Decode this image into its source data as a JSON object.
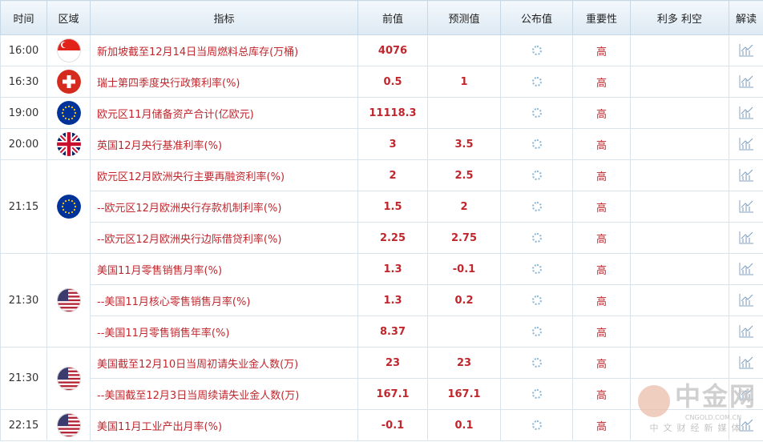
{
  "headers": {
    "time": "时间",
    "region": "区域",
    "indicator": "指标",
    "previous": "前值",
    "forecast": "预测值",
    "published": "公布值",
    "importance": "重要性",
    "bull_bear": "利多 利空",
    "analysis": "解读"
  },
  "groups": [
    {
      "time": "16:00",
      "flag": "singapore-flag-icon",
      "rows": [
        {
          "indicator": "新加坡截至12月14日当周燃料总库存(万桶)",
          "previous": "4076",
          "forecast": "",
          "importance": "高"
        }
      ]
    },
    {
      "time": "16:30",
      "flag": "switzerland-flag-icon",
      "rows": [
        {
          "indicator": "瑞士第四季度央行政策利率(%)",
          "previous": "0.5",
          "forecast": "1",
          "importance": "高"
        }
      ]
    },
    {
      "time": "19:00",
      "flag": "eu-flag-icon",
      "rows": [
        {
          "indicator": "欧元区11月储备资产合计(亿欧元)",
          "previous": "11118.3",
          "forecast": "",
          "importance": "高"
        }
      ]
    },
    {
      "time": "20:00",
      "flag": "uk-flag-icon",
      "rows": [
        {
          "indicator": "英国12月央行基准利率(%)",
          "previous": "3",
          "forecast": "3.5",
          "importance": "高"
        }
      ]
    },
    {
      "time": "21:15",
      "flag": "eu-flag-icon",
      "rows": [
        {
          "indicator": "欧元区12月欧洲央行主要再融资利率(%)",
          "previous": "2",
          "forecast": "2.5",
          "importance": "高"
        },
        {
          "indicator": "--欧元区12月欧洲央行存款机制利率(%)",
          "previous": "1.5",
          "forecast": "2",
          "importance": "高"
        },
        {
          "indicator": "--欧元区12月欧洲央行边际借贷利率(%)",
          "previous": "2.25",
          "forecast": "2.75",
          "importance": "高"
        }
      ]
    },
    {
      "time": "21:30",
      "flag": "us-flag-icon",
      "rows": [
        {
          "indicator": "美国11月零售销售月率(%)",
          "previous": "1.3",
          "forecast": "-0.1",
          "importance": "高"
        },
        {
          "indicator": "--美国11月核心零售销售月率(%)",
          "previous": "1.3",
          "forecast": "0.2",
          "importance": "高"
        },
        {
          "indicator": "--美国11月零售销售年率(%)",
          "previous": "8.37",
          "forecast": "",
          "importance": "高"
        }
      ]
    },
    {
      "time": "21:30",
      "flag": "us-flag-icon",
      "rows": [
        {
          "indicator": "美国截至12月10日当周初请失业金人数(万)",
          "previous": "23",
          "forecast": "23",
          "importance": "高"
        },
        {
          "indicator": "--美国截至12月3日当周续请失业金人数(万)",
          "previous": "167.1",
          "forecast": "167.1",
          "importance": "高"
        }
      ]
    },
    {
      "time": "22:15",
      "flag": "us-flag-icon",
      "rows": [
        {
          "indicator": "美国11月工业产出月率(%)",
          "previous": "-0.1",
          "forecast": "0.1",
          "importance": "高"
        }
      ]
    }
  ],
  "watermark": {
    "logo": "中金网",
    "url": "CNGOLD.COM.CN",
    "sub": "中文财经新媒体"
  }
}
